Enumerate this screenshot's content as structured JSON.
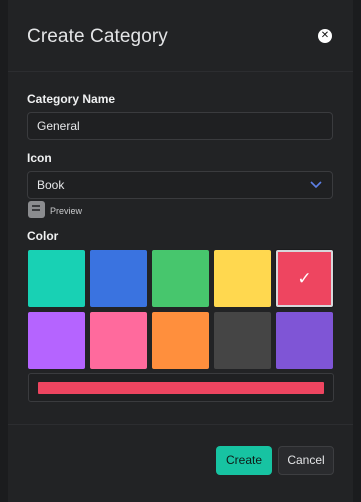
{
  "modal": {
    "title": "Create Category",
    "close_icon": "close-icon"
  },
  "form": {
    "category_name": {
      "label": "Category Name",
      "value": "General"
    },
    "icon": {
      "label": "Icon",
      "selected": "Book",
      "chevron_icon": "chevron-down-icon",
      "preview_icon": "book-icon",
      "preview_label": "Preview"
    },
    "color": {
      "label": "Color",
      "selected_index": 4,
      "swatches": [
        "#18d1b4",
        "#3a73e0",
        "#47c66d",
        "#ffd84f",
        "#ee4560",
        "#b564ff",
        "#ff6a9d",
        "#ff8f3d",
        "#454545",
        "#7f55d6"
      ],
      "selected_color": "#ee4560",
      "check_glyph": "✓"
    }
  },
  "footer": {
    "create_label": "Create",
    "cancel_label": "Cancel"
  }
}
